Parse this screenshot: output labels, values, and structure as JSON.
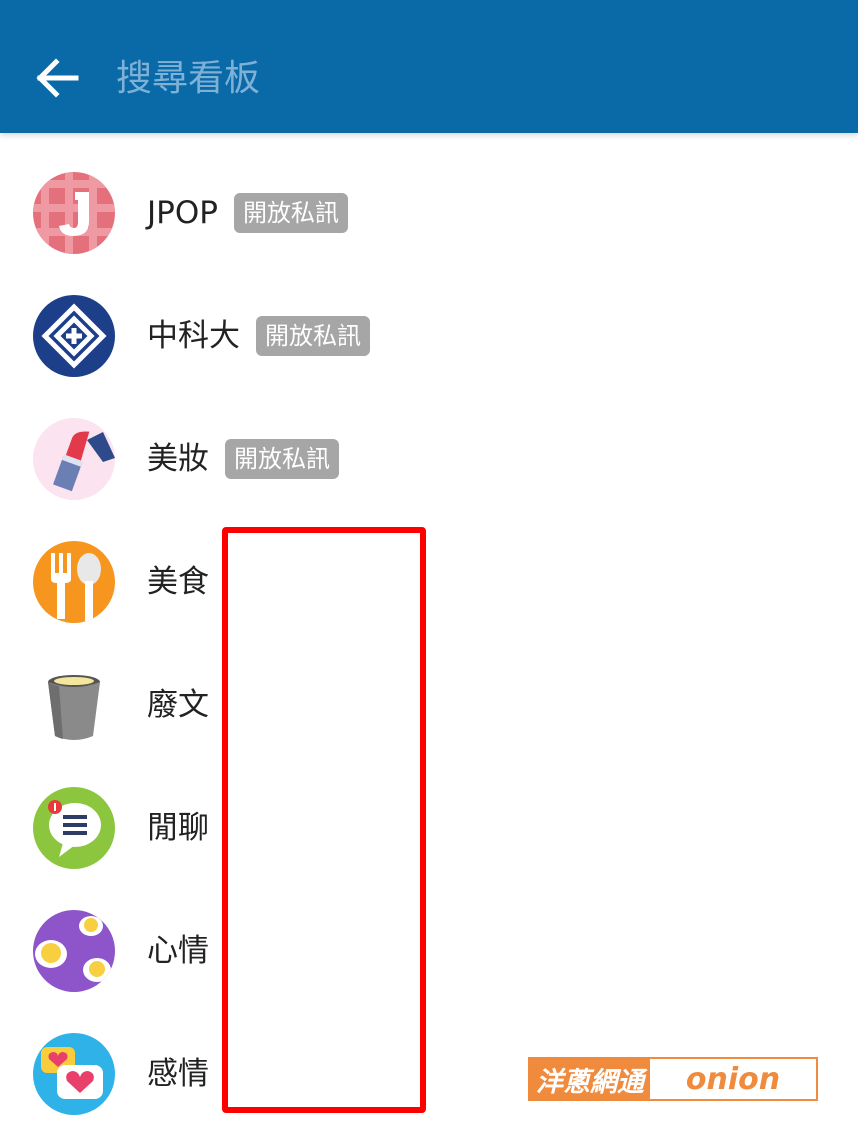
{
  "header": {
    "search_placeholder": "搜尋看板",
    "back_icon": "arrow-left-icon"
  },
  "boards": [
    {
      "name": "JPOP",
      "badge": "開放私訊",
      "icon": "letter-j-icon"
    },
    {
      "name": "中科大",
      "badge": "開放私訊",
      "icon": "university-logo-icon"
    },
    {
      "name": "美妝",
      "badge": "開放私訊",
      "icon": "lipstick-icon"
    },
    {
      "name": "美食",
      "icon": "fork-spoon-icon"
    },
    {
      "name": "廢文",
      "icon": "trash-can-icon"
    },
    {
      "name": "閒聊",
      "icon": "chat-bubble-icon"
    },
    {
      "name": "心情",
      "icon": "emoji-faces-icon"
    },
    {
      "name": "感情",
      "icon": "hearts-icon"
    }
  ],
  "watermark": {
    "cn": "洋蔥網通",
    "en": "onion"
  },
  "colors": {
    "appbar": "#0a6aa8",
    "badge": "#a6a6a6",
    "highlight": "#ff0000",
    "watermark": "#f08a3c"
  }
}
